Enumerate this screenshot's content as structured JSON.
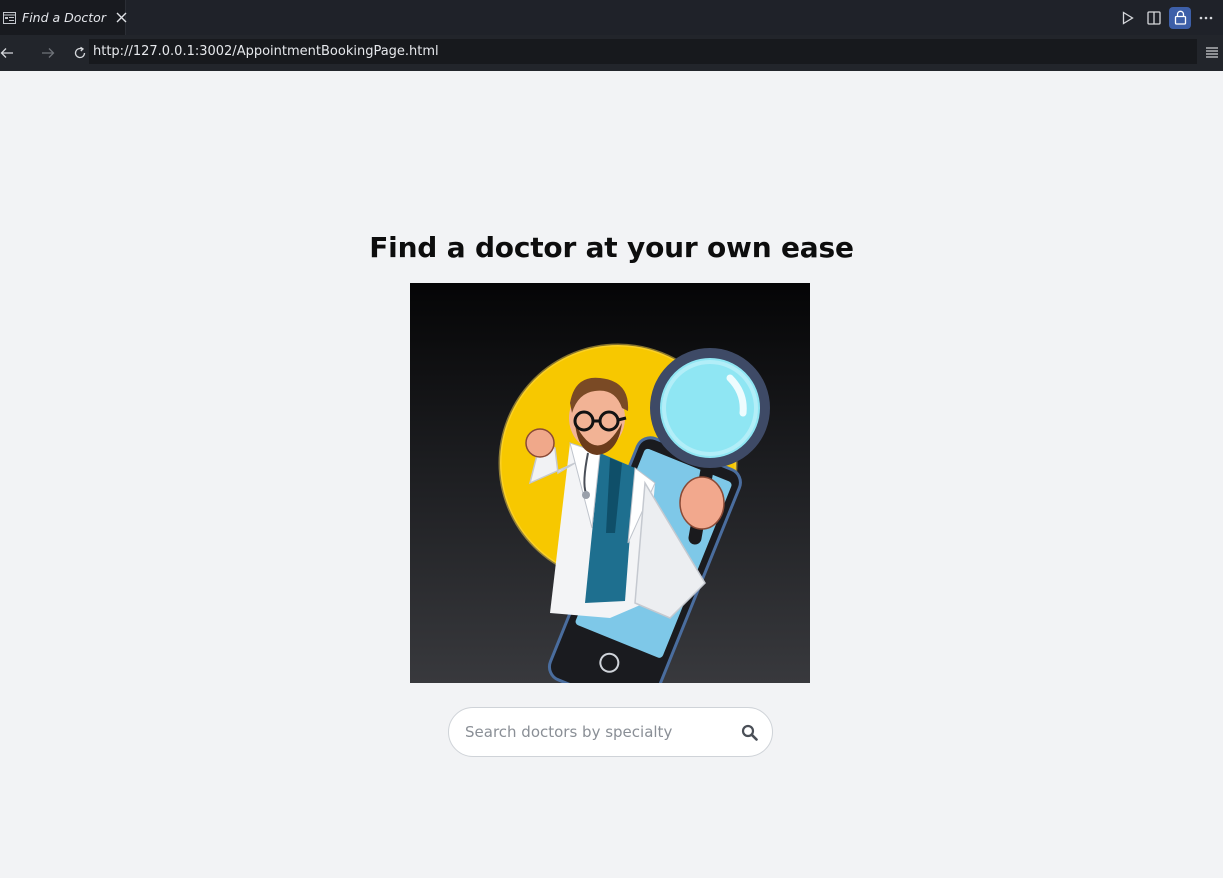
{
  "tab": {
    "title": "Find a Doctor",
    "icon": "browser-preview-icon",
    "close_icon": "close-icon"
  },
  "toolbar_actions": [
    "run-icon",
    "split-editor-icon",
    "lock-icon",
    "more-icon"
  ],
  "address_bar": {
    "url": "http://127.0.0.1:3002/AppointmentBookingPage.html"
  },
  "page": {
    "heading": "Find a doctor at your own ease",
    "hero_image": "doctor-with-magnifying-glass-illustration",
    "search": {
      "placeholder": "Search doctors by specialty",
      "value": "",
      "icon": "search-icon"
    }
  },
  "colors": {
    "editor_tab_bg": "#1f2229",
    "page_bg": "#f2f3f5",
    "accent_active": "#3d5fa8",
    "sun_yellow": "#f7c800"
  }
}
